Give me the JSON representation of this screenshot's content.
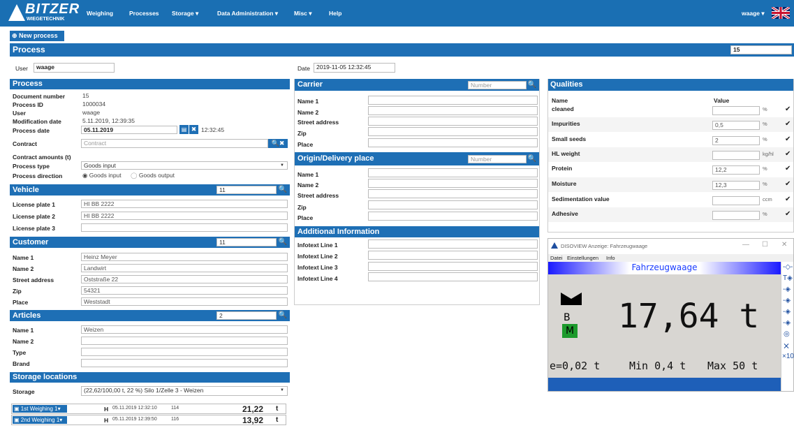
{
  "nav": {
    "logo_text": "BITZER",
    "logo_sub": "WIEGETECHNIK",
    "items": [
      "Weighing",
      "Processes",
      "Storage ▾",
      "Data Administration ▾",
      "Misc ▾",
      "Help"
    ],
    "user_menu": "waage ▾"
  },
  "new_process_label": "New process",
  "process_header": {
    "title": "Process",
    "number": "15"
  },
  "user_row": {
    "user_label": "User",
    "user_value": "waage",
    "date_label": "Date",
    "date_value": "2019-11-05 12:32:45"
  },
  "process": {
    "title": "Process",
    "fields": [
      {
        "label": "Document number",
        "value": "15"
      },
      {
        "label": "Process ID",
        "value": "1000034"
      },
      {
        "label": "User",
        "value": "waage"
      },
      {
        "label": "Modification date",
        "value": "5.11.2019, 12:39:35"
      }
    ],
    "process_date_label": "Process date",
    "process_date": "05.11.2019",
    "process_time": "12:32:45",
    "contract_label": "Contract",
    "contract_placeholder": "Contract",
    "contract_amounts_label": "Contract amounts (t)",
    "process_type_label": "Process type",
    "process_type": "Goods input",
    "direction_label": "Process direction",
    "direction_options": [
      "Goods input",
      "Goods output"
    ]
  },
  "vehicle": {
    "title": "Vehicle",
    "search": "11",
    "fields": [
      {
        "label": "License plate 1",
        "value": "HI BB 2222"
      },
      {
        "label": "License plate 2",
        "value": "HI BB 2222"
      },
      {
        "label": "License plate 3",
        "value": ""
      }
    ]
  },
  "customer": {
    "title": "Customer",
    "search": "11",
    "fields": [
      {
        "label": "Name 1",
        "value": "Heinz Meyer"
      },
      {
        "label": "Name 2",
        "value": "Landwirt"
      },
      {
        "label": "Street address",
        "value": "Oststraße 22"
      },
      {
        "label": "Zip",
        "value": "54321"
      },
      {
        "label": "Place",
        "value": "Weststadt"
      }
    ]
  },
  "articles": {
    "title": "Articles",
    "search": "2",
    "fields": [
      {
        "label": "Name 1",
        "value": "Weizen"
      },
      {
        "label": "Name 2",
        "value": ""
      },
      {
        "label": "Type",
        "value": ""
      },
      {
        "label": "Brand",
        "value": ""
      }
    ]
  },
  "storage": {
    "title": "Storage locations",
    "label": "Storage",
    "value": "(22,62/100,00 t, 22 %) Silo 1/Zelle 3 - Weizen"
  },
  "weighings": [
    {
      "label": "1st Weighing",
      "count": "1▾",
      "mode": "H",
      "time": "05.11.2019 12:32:10",
      "id": "114",
      "weight": "21,22",
      "unit": "t"
    },
    {
      "label": "2nd Weighing",
      "count": "1▾",
      "mode": "H",
      "time": "05.11.2019 12:39:50",
      "id": "116",
      "weight": "13,92",
      "unit": "t"
    }
  ],
  "carrier": {
    "title": "Carrier",
    "search_placeholder": "Number",
    "fields": [
      "Name 1",
      "Name 2",
      "Street address",
      "Zip",
      "Place"
    ]
  },
  "origin": {
    "title": "Origin/Delivery place",
    "search_placeholder": "Number",
    "fields": [
      "Name 1",
      "Name 2",
      "Street address",
      "Zip",
      "Place"
    ]
  },
  "additional": {
    "title": "Additional Information",
    "fields": [
      "Infotext Line 1",
      "Infotext Line 2",
      "Infotext Line 3",
      "Infotext Line 4"
    ]
  },
  "qualities": {
    "title": "Qualities",
    "col_name": "Name",
    "col_value": "Value",
    "rows": [
      {
        "name": "cleaned",
        "value": "",
        "unit": "%"
      },
      {
        "name": "Impurities",
        "value": "0,5",
        "unit": "%"
      },
      {
        "name": "Small seeds",
        "value": "2",
        "unit": "%"
      },
      {
        "name": "HL weight",
        "value": "",
        "unit": "kg/hl"
      },
      {
        "name": "Protein",
        "value": "12,2",
        "unit": "%"
      },
      {
        "name": "Moisture",
        "value": "12,3",
        "unit": "%"
      },
      {
        "name": "Sedimentation value",
        "value": "",
        "unit": "ccm"
      },
      {
        "name": "Adhesive",
        "value": "",
        "unit": "%"
      }
    ]
  },
  "display": {
    "window_title": "DISOVIEW Anzeige: Fahrzeugwaage",
    "menu": [
      "Datei",
      "Einstellungen",
      "Info"
    ],
    "scale_name": "Fahrzeugwaage",
    "weight": "17,64 t",
    "mode_b": "B",
    "mode_m": "M",
    "e_value": "e=0,02 t",
    "min_value": "Min 0,4 t",
    "max_value": "Max 50 t",
    "side_bottom": "×10",
    "controls": [
      "—",
      "☐",
      "✕"
    ]
  },
  "colors": {
    "brand": "#1e6fb5",
    "nav": "#1a6fb3"
  }
}
